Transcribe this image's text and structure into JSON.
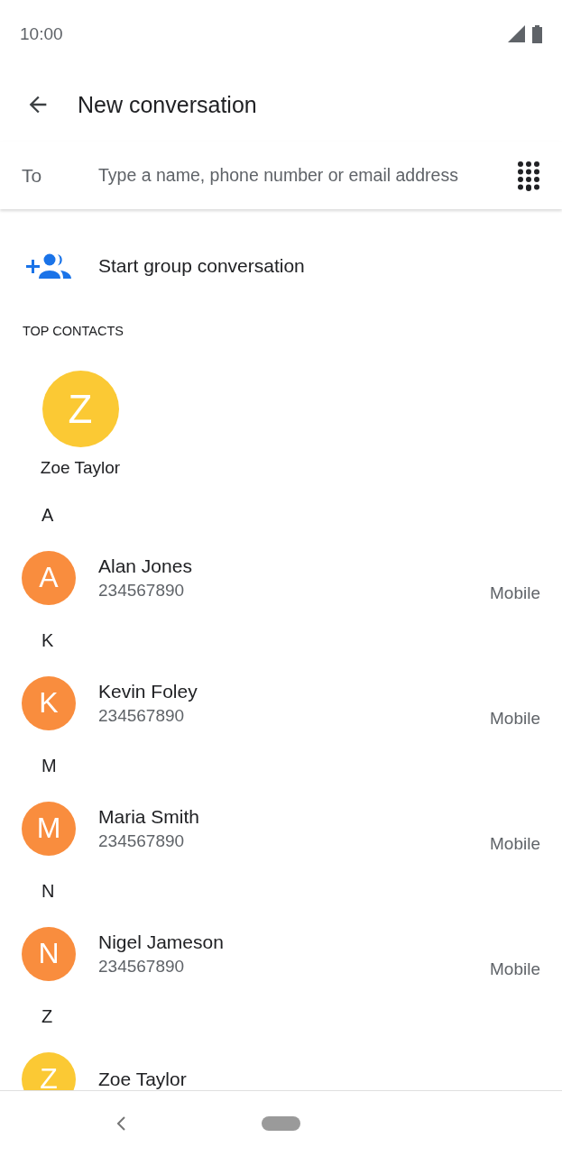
{
  "status_bar": {
    "time": "10:00"
  },
  "header": {
    "title": "New conversation"
  },
  "recipient": {
    "label": "To",
    "placeholder": "Type a name, phone number or email address"
  },
  "group_action": {
    "label": "Start group conversation"
  },
  "top_contacts": {
    "heading": "TOP CONTACTS",
    "contacts": [
      {
        "initial": "Z",
        "name": "Zoe Taylor",
        "color": "#fbc934"
      }
    ]
  },
  "sections": [
    {
      "letter": "A",
      "contacts": [
        {
          "initial": "A",
          "name": "Alan Jones",
          "number": "234567890",
          "type": "Mobile",
          "color": "#f98d3e"
        }
      ]
    },
    {
      "letter": "K",
      "contacts": [
        {
          "initial": "K",
          "name": "Kevin Foley",
          "number": "234567890",
          "type": "Mobile",
          "color": "#f98d3e"
        }
      ]
    },
    {
      "letter": "M",
      "contacts": [
        {
          "initial": "M",
          "name": "Maria Smith",
          "number": "234567890",
          "type": "Mobile",
          "color": "#f98d3e"
        }
      ]
    },
    {
      "letter": "N",
      "contacts": [
        {
          "initial": "N",
          "name": "Nigel Jameson",
          "number": "234567890",
          "type": "Mobile",
          "color": "#f98d3e"
        }
      ]
    },
    {
      "letter": "Z",
      "contacts": [
        {
          "initial": "Z",
          "name": "Zoe Taylor",
          "color": "#fbc934"
        }
      ]
    }
  ]
}
